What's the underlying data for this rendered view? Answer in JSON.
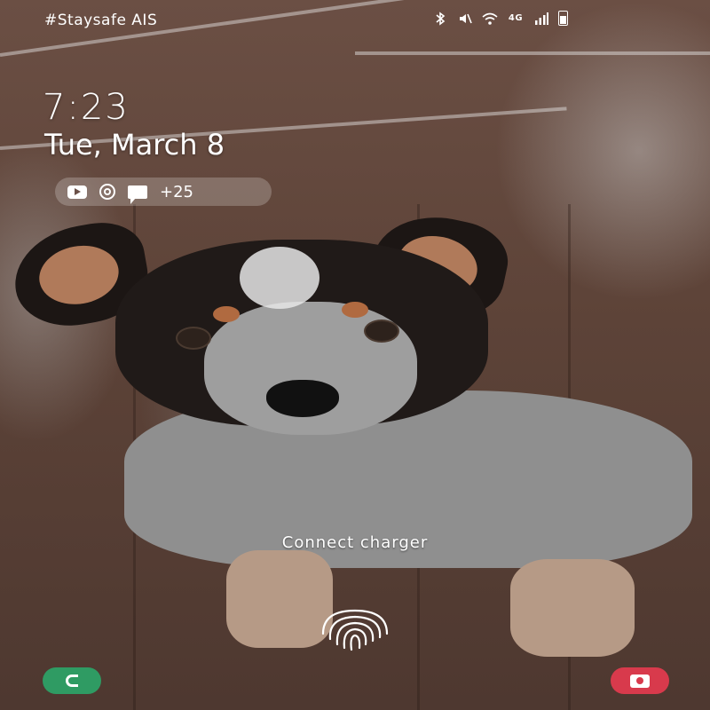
{
  "status_bar": {
    "carrier": "#Staysafe AIS",
    "icons": [
      "bluetooth-icon",
      "mute-icon",
      "wifi-icon",
      "4g-icon",
      "signal-icon",
      "battery-icon"
    ],
    "network_label": "4G"
  },
  "lock_screen": {
    "time": "7:23",
    "date": "Tue, March 8",
    "notifications": {
      "icons": [
        "youtube-icon",
        "at-sign-icon",
        "message-icon"
      ],
      "more_count": "+25"
    },
    "charger_message": "Connect charger"
  },
  "shortcuts": {
    "left": "phone-icon",
    "right": "camera-icon",
    "phone_color": "#2f9b63",
    "camera_color": "#d83a4c"
  },
  "wallpaper": {
    "subject": "puppy-photo"
  }
}
